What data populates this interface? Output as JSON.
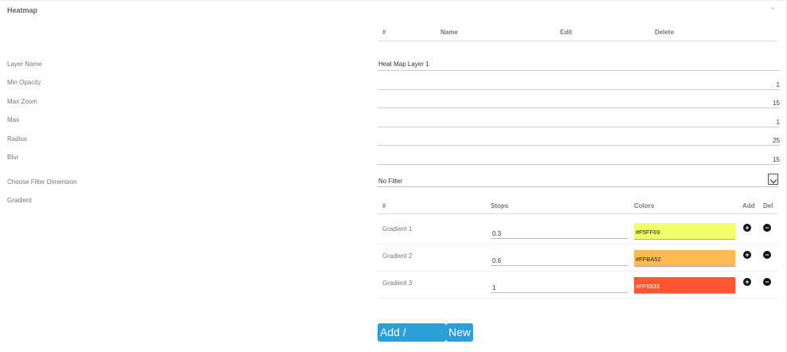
{
  "panel": {
    "title": "Heatmap"
  },
  "icons": {
    "collapse": "chevron-up-icon",
    "add": "plus-circle-icon",
    "delete": "minus-circle-icon",
    "select_arrow": "chevron-down-icon"
  },
  "layers_table": {
    "headers": [
      "#",
      "Name",
      "Edit",
      "Delete"
    ]
  },
  "fields": {
    "layer_name": {
      "label": "Layer Name",
      "value": "Heat Map Layer 1"
    },
    "min_opacity": {
      "label": "Min Opacity",
      "value": "1"
    },
    "max_zoom": {
      "label": "Max Zoom",
      "value": "15"
    },
    "max": {
      "label": "Max",
      "value": "1"
    },
    "radius": {
      "label": "Radius",
      "value": "25"
    },
    "blur": {
      "label": "Blur",
      "value": "15"
    },
    "filter": {
      "label": "Choose Filter Dimension",
      "value": "No Filter"
    },
    "gradient_label": "Gradient"
  },
  "gradient_table": {
    "headers": {
      "num": "#",
      "stops": "Stops",
      "colors": "Colors",
      "add": "Add",
      "del": "Del"
    },
    "rows": [
      {
        "name": "Gradient 1",
        "stop": "0.3",
        "color": "#F5FF69",
        "swatch": "#f2ff69"
      },
      {
        "name": "Gradient 2",
        "stop": "0.6",
        "color": "#FFBA52",
        "swatch": "#ffba52"
      },
      {
        "name": "Gradient 3",
        "stop": "1",
        "color": "#FF5533",
        "swatch": "#ff5533"
      }
    ]
  },
  "buttons": {
    "add_update": "Add / Update",
    "new": "New"
  },
  "colors": {
    "accent": "#2ba0d8"
  }
}
